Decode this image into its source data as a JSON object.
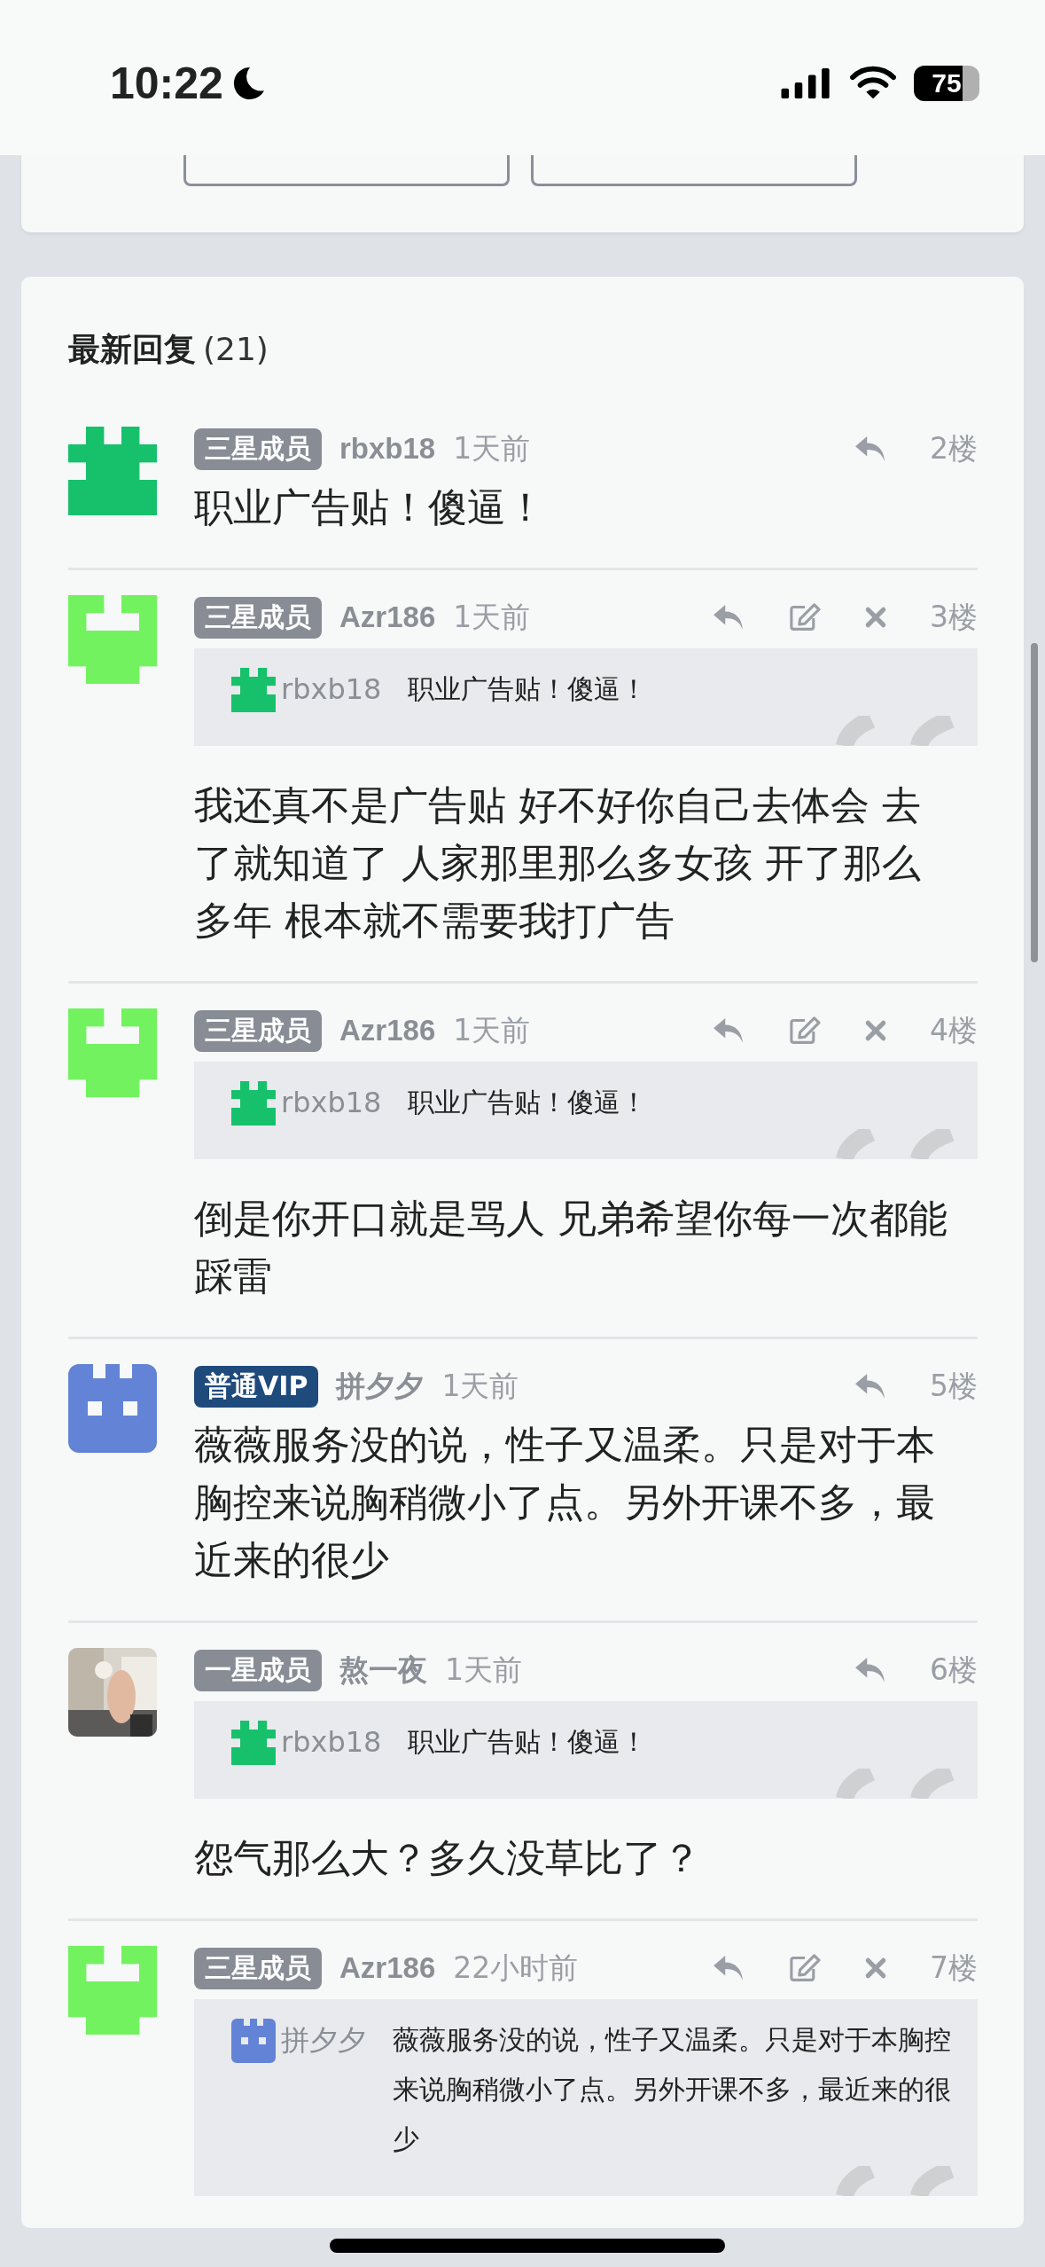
{
  "status_bar": {
    "time": "10:22",
    "battery": "75"
  },
  "replies": {
    "title": "最新回复",
    "count": "(21)",
    "comments": [
      {
        "avatar": {
          "kind": "tower",
          "color": "#17c16c"
        },
        "rank": {
          "label": "三星成员",
          "color": "#878c95"
        },
        "author": "rbxb18",
        "time": "1天前",
        "editable": false,
        "floor": "2楼",
        "text": "职业广告贴！傻逼！"
      },
      {
        "avatar": {
          "kind": "face",
          "color": "#72f25f"
        },
        "rank": {
          "label": "三星成员",
          "color": "#878c95"
        },
        "author": "Azr186",
        "time": "1天前",
        "editable": true,
        "floor": "3楼",
        "quote": {
          "avatar": {
            "kind": "tower",
            "color": "#17c16c"
          },
          "author": "rbxb18",
          "text": "职业广告贴！傻逼！"
        },
        "text": "我还真不是广告贴 好不好你自己去体会 去了就知道了 人家那里那么多女孩 开了那么多年 根本就不需要我打广告"
      },
      {
        "avatar": {
          "kind": "face",
          "color": "#72f25f"
        },
        "rank": {
          "label": "三星成员",
          "color": "#878c95"
        },
        "author": "Azr186",
        "time": "1天前",
        "editable": true,
        "floor": "4楼",
        "quote": {
          "avatar": {
            "kind": "tower",
            "color": "#17c16c"
          },
          "author": "rbxb18",
          "text": "职业广告贴！傻逼！"
        },
        "text": "倒是你开口就是骂人 兄弟希望你每一次都能踩雷"
      },
      {
        "avatar": {
          "kind": "blocks",
          "color": "#6383d6"
        },
        "rank": {
          "label": "普通VIP",
          "color": "#1f4a7c"
        },
        "author": "拼夕夕",
        "time": "1天前",
        "editable": false,
        "floor": "5楼",
        "text": "薇薇服务没的说，性子又温柔。只是对于本胸控来说胸稍微小了点。另外开课不多，最近来的很少"
      },
      {
        "rank": {
          "label": "一星成员",
          "color": "#878c95"
        },
        "author": "熬一夜",
        "time": "1天前",
        "editable": false,
        "floor": "6楼",
        "quote": {
          "avatar": {
            "kind": "tower",
            "color": "#17c16c"
          },
          "author": "rbxb18",
          "text": "职业广告贴！傻逼！"
        },
        "text": "怨气那么大？多久没草比了？"
      },
      {
        "avatar": {
          "kind": "face",
          "color": "#72f25f"
        },
        "rank": {
          "label": "三星成员",
          "color": "#878c95"
        },
        "author": "Azr186",
        "time": "22小时前",
        "editable": true,
        "floor": "7楼",
        "quote": {
          "avatar": {
            "kind": "blocks",
            "color": "#6383d6"
          },
          "author": "拼夕夕",
          "text": "薇薇服务没的说，性子又温柔。只是对于本胸控来说胸稍微小了点。另外开课不多，最近来的很少"
        }
      }
    ]
  }
}
